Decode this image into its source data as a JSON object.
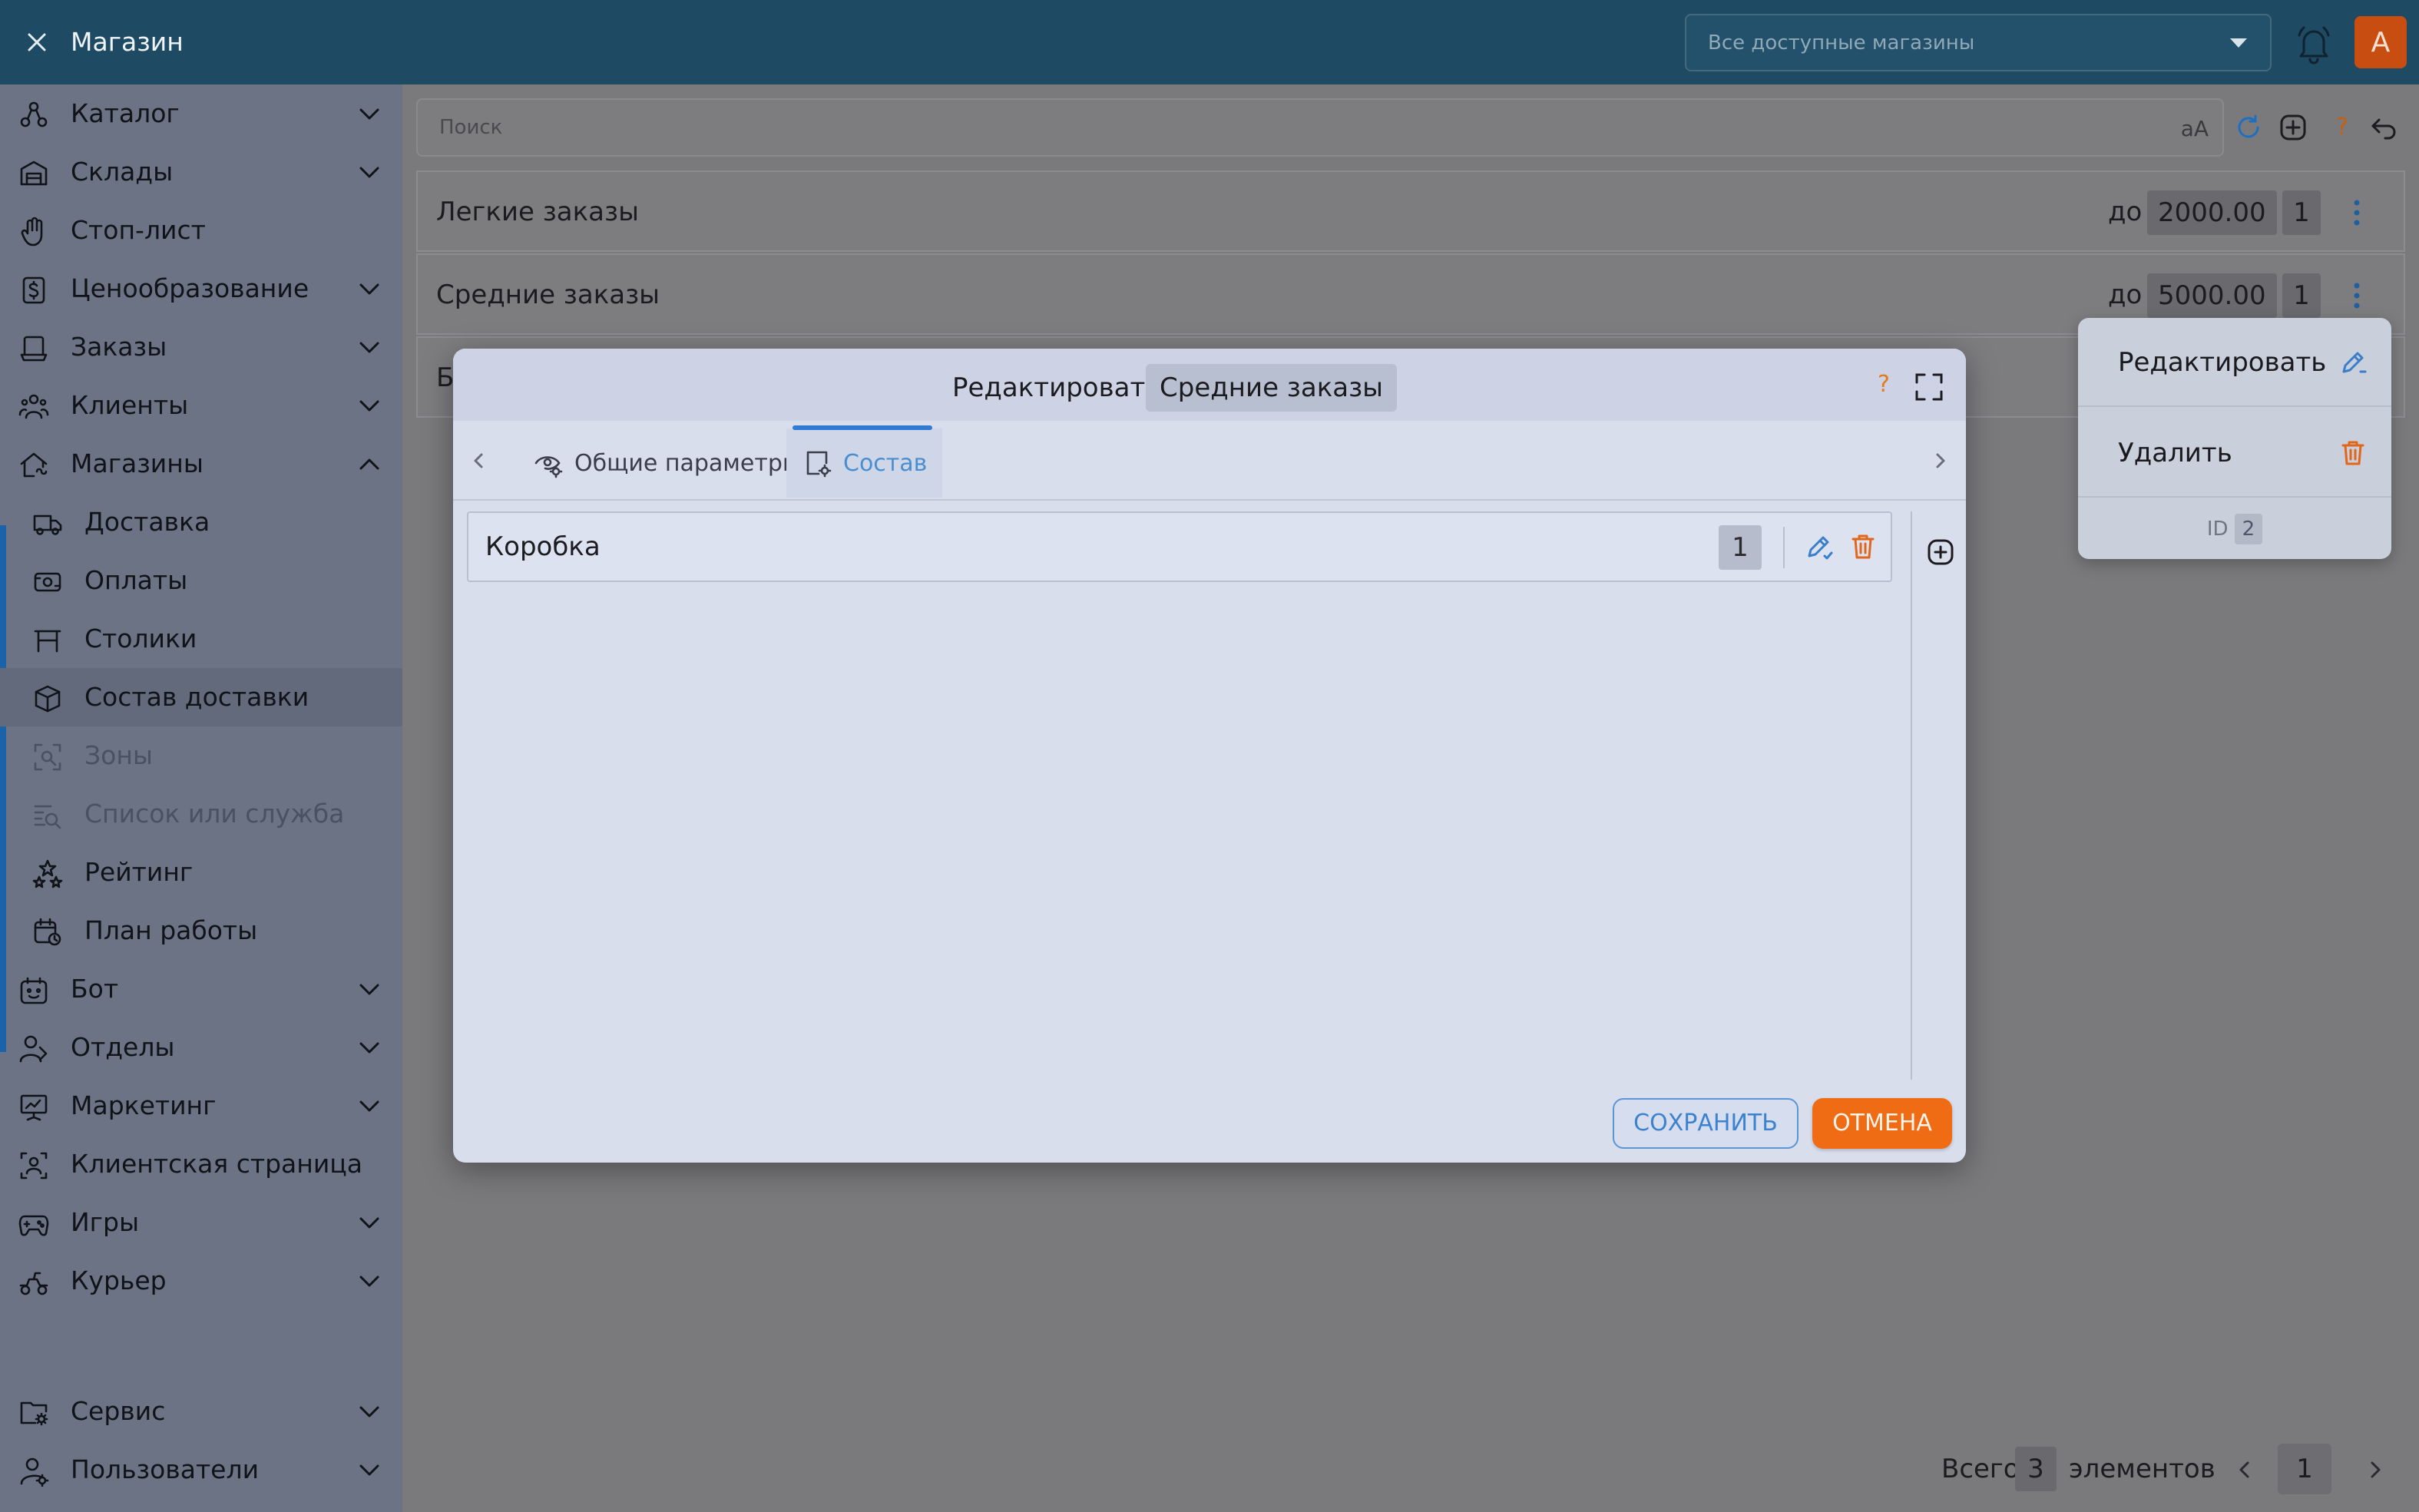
{
  "header": {
    "title": "Магазин",
    "store_select": {
      "value": "Все доступные магазины"
    },
    "avatar_letter": "A"
  },
  "sidebar": {
    "items": [
      {
        "label": "Каталог",
        "icon": "catalog-icon",
        "expandable": true
      },
      {
        "label": "Склады",
        "icon": "warehouse-icon",
        "expandable": true
      },
      {
        "label": "Стоп-лист",
        "icon": "hand-stop-icon",
        "expandable": false
      },
      {
        "label": "Ценообразование",
        "icon": "pricing-icon",
        "expandable": true
      },
      {
        "label": "Заказы",
        "icon": "orders-icon",
        "expandable": true
      },
      {
        "label": "Клиенты",
        "icon": "clients-icon",
        "expandable": true
      },
      {
        "label": "Магазины",
        "icon": "stores-icon",
        "expandable": true,
        "expanded": true
      },
      {
        "label": "Доставка",
        "icon": "truck-icon",
        "sub": true
      },
      {
        "label": "Оплаты",
        "icon": "payments-icon",
        "sub": true
      },
      {
        "label": "Столики",
        "icon": "table-icon",
        "sub": true
      },
      {
        "label": "Состав доставки",
        "icon": "box-icon",
        "sub": true,
        "active": true
      },
      {
        "label": "Зоны",
        "icon": "zones-icon",
        "sub": true,
        "disabled": true
      },
      {
        "label": "Список или служба",
        "icon": "list-search-icon",
        "sub": true,
        "disabled": true
      },
      {
        "label": "Рейтинг",
        "icon": "stars-icon",
        "sub": true
      },
      {
        "label": "План работы",
        "icon": "calendar-icon",
        "sub": true
      },
      {
        "label": "Бот",
        "icon": "bot-icon",
        "expandable": true
      },
      {
        "label": "Отделы",
        "icon": "departments-icon",
        "expandable": true
      },
      {
        "label": "Маркетинг",
        "icon": "marketing-icon",
        "expandable": true
      },
      {
        "label": "Клиентская страница",
        "icon": "client-page-icon",
        "expandable": false
      },
      {
        "label": "Игры",
        "icon": "gamepad-icon",
        "expandable": true
      },
      {
        "label": "Курьер",
        "icon": "courier-icon",
        "expandable": true
      },
      {
        "label": "Сервис",
        "icon": "service-folder-icon",
        "expandable": true
      },
      {
        "label": "Пользователи",
        "icon": "users-icon",
        "expandable": true
      }
    ]
  },
  "search": {
    "placeholder": "Поиск",
    "case_toggle": "aA"
  },
  "list": {
    "rows": [
      {
        "name": "Легкие заказы",
        "prefix": "до",
        "price": "2000.00",
        "count": "1"
      },
      {
        "name": "Средние заказы",
        "prefix": "до",
        "price": "5000.00",
        "count": "1"
      },
      {
        "name": "Б"
      }
    ]
  },
  "context_menu": {
    "edit_label": "Редактировать",
    "delete_label": "Удалить",
    "id_label": "ID",
    "id_value": "2"
  },
  "footer": {
    "total_prefix": "Всего",
    "total_count": "3",
    "total_suffix": "элементов",
    "page": "1"
  },
  "modal": {
    "title_prefix": "Редактировать",
    "title_name": "Средние заказы",
    "help": "?",
    "tabs": [
      {
        "label": "Общие параметры",
        "icon": "eye-settings-icon"
      },
      {
        "label": "Состав",
        "icon": "composition-icon",
        "active": true
      }
    ],
    "item": {
      "name": "Коробка",
      "count": "1"
    },
    "save_label": "СОХРАНИТЬ",
    "cancel_label": "ОТМЕНА"
  },
  "colors": {
    "topbar": "#1f4a63",
    "accent_blue": "#2f7bd4",
    "accent_orange": "#ef6c14"
  }
}
